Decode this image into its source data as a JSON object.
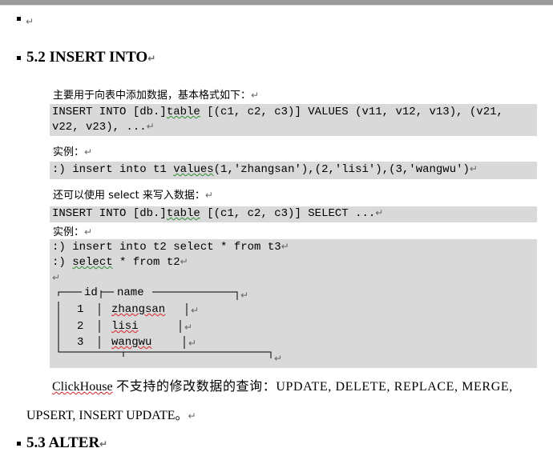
{
  "bullet_top": "",
  "section_52": {
    "heading": "5.2 INSERT INTO",
    "intro": "主要用于向表中添加数据，基本格式如下：",
    "syntax_line1_pre": "INSERT INTO [db.]",
    "syntax_line1_kw": "table",
    "syntax_line1_post": " [(c1, c2, c3)] VALUES (v11, v12, v13), (v21,",
    "syntax_line2": "v22, v23), ...",
    "example_label1": "实例：",
    "example1_pre": ":) insert into t1 ",
    "example1_kw": "values",
    "example1_post": "(1,'zhangsan'),(2,'lisi'),(3,'wangwu')",
    "select_intro": "还可以使用 select 来写入数据：",
    "syntax2_pre": "INSERT INTO [db.]",
    "syntax2_kw": "table",
    "syntax2_post": " [(c1, c2, c3)] SELECT ...",
    "example_label2": "实例：",
    "example2_line1": ":) insert into t2 select * from t3",
    "example2_line2_pre": ":) ",
    "example2_line2_kw": "select",
    "example2_line2_post": " * from t2",
    "result_table": {
      "headers": [
        "id",
        "name"
      ],
      "rows": [
        [
          "1",
          "zhangsan"
        ],
        [
          "2",
          "lisi"
        ],
        [
          "3",
          "wangwu"
        ]
      ]
    },
    "note_line1_app": "ClickHouse",
    "note_line1_rest": " 不支持的修改数据的查询：UPDATE, DELETE, REPLACE, MERGE,",
    "note_line2": "UPSERT, INSERT UPDATE。"
  },
  "section_53": {
    "heading": "5.3 ALTER"
  }
}
